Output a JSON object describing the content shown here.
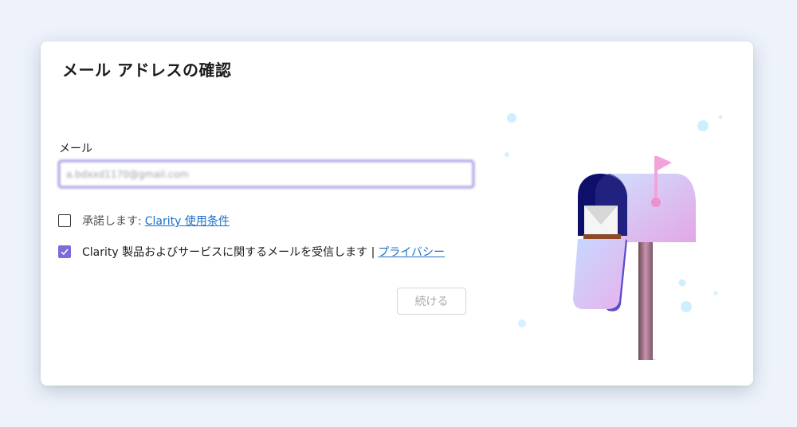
{
  "dialog": {
    "title": "メール アドレスの確認",
    "email": {
      "label": "メール",
      "value": "a.bdxxd1170@gmail.com"
    },
    "terms": {
      "checked": false,
      "prefix": "承諾します:",
      "link": "Clarity 使用条件"
    },
    "marketing": {
      "checked": true,
      "text": "Clarity 製品およびサービスに関するメールを受信します |",
      "link": "プライバシー"
    },
    "continue_label": "続ける",
    "illustration": "mailbox-illustration"
  },
  "colors": {
    "accent": "#7b6cd9",
    "link": "#1a6fc9",
    "background": "#eef3fb"
  }
}
